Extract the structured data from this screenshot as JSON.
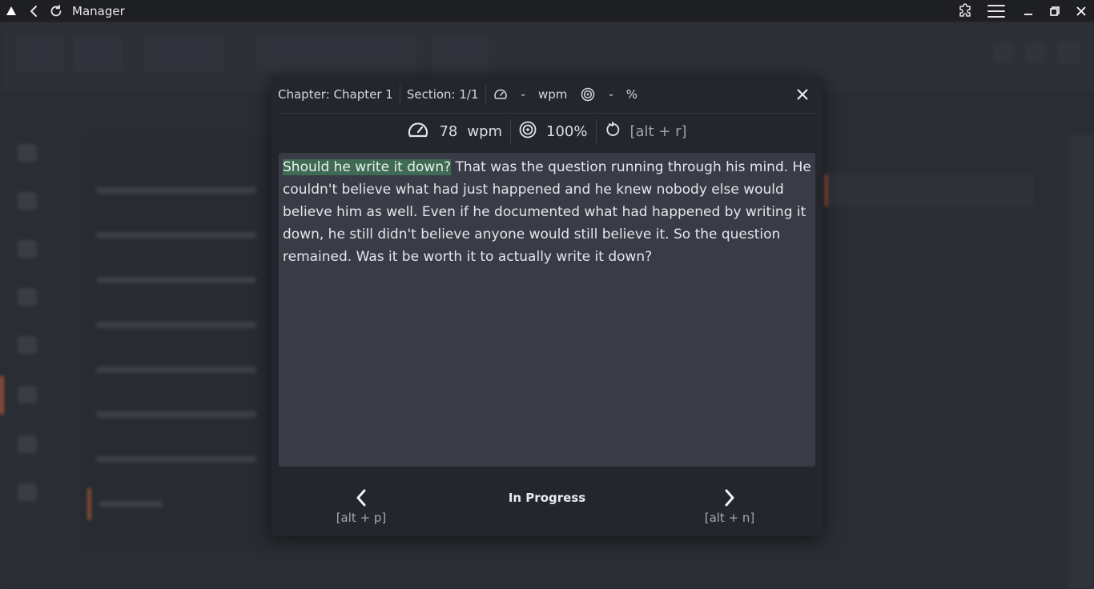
{
  "window": {
    "title": "Manager",
    "icons": [
      "app-logo-icon",
      "back-icon",
      "refresh-icon",
      "extensions-icon",
      "menu-icon",
      "minimize-icon",
      "maximize-icon",
      "close-icon"
    ]
  },
  "modal": {
    "header": {
      "chapter": "Chapter: Chapter 1",
      "section": "Section: 1/1",
      "speed_value": "-",
      "speed_unit": "wpm",
      "accuracy_value": "-",
      "accuracy_unit": "%"
    },
    "stats": {
      "wpm_value": "78",
      "wpm_unit": "wpm",
      "accuracy": "100%",
      "restart_shortcut": "[alt + r]"
    },
    "text": {
      "typed": "Should he write it down?",
      "remaining": " That was the question running through his mind. He couldn't believe what had just happened and he knew nobody else would believe him as well. Even if he documented what had happened by writing it down, he still didn't believe anyone would still believe it. So the question remained. Was it be worth it to actually write it down?"
    },
    "footer": {
      "prev_shortcut": "[alt + p]",
      "status": "In Progress",
      "next_shortcut": "[alt + n]"
    }
  },
  "colors": {
    "accent_highlight": "#3f6b55",
    "modal_bg": "#23262c",
    "text_area_bg": "#393c46",
    "titlebar_bg": "#1e1f22"
  }
}
